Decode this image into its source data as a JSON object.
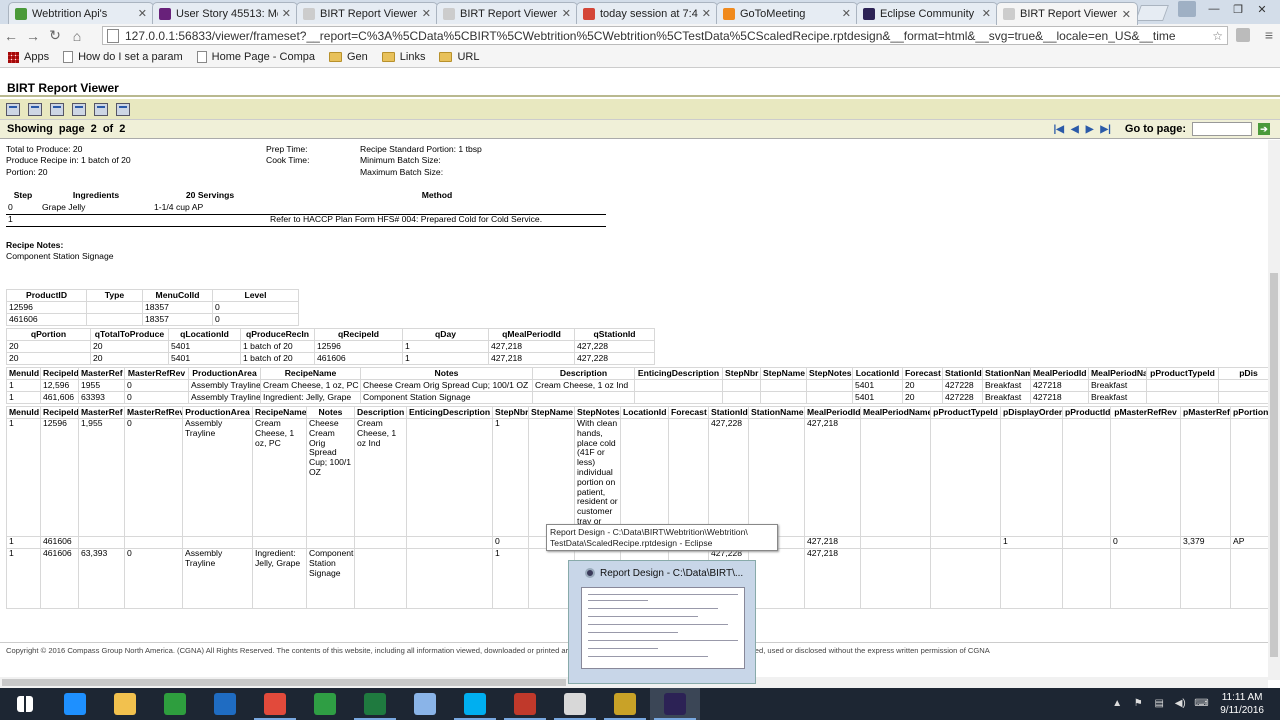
{
  "browser": {
    "tabs": [
      {
        "title": "Webtrition Api's",
        "color": "#4a9a3a",
        "active": false
      },
      {
        "title": "User Story 45513: Men",
        "color": "#68217a",
        "active": false
      },
      {
        "title": "BIRT Report Viewer",
        "color": "#cccccc",
        "active": false
      },
      {
        "title": "BIRT Report Viewer",
        "color": "#cccccc",
        "active": false
      },
      {
        "title": "today session at 7:45p",
        "color": "#d44638",
        "active": false
      },
      {
        "title": "GoToMeeting",
        "color": "#f08a1d",
        "active": false
      },
      {
        "title": "Eclipse Community Fo",
        "color": "#2c2255",
        "active": false
      },
      {
        "title": "BIRT Report Viewer",
        "color": "#cccccc",
        "active": true
      }
    ],
    "url": "127.0.0.1:56833/viewer/frameset?__report=C%3A%5CData%5CBIRT%5CWebtrition%5CWebtrition%5CTestData%5CScaledRecipe.rptdesign&__format=html&__svg=true&__locale=en_US&__time",
    "bookmarks": [
      "Apps",
      "How do I set a param",
      "Home Page - Compa",
      "Gen",
      "Links",
      "URL"
    ]
  },
  "viewer": {
    "title": "BIRT Report Viewer",
    "showing_label": "Showing page",
    "page_current": "2",
    "of_label": "of",
    "page_total": "2",
    "goto_label": "Go to page:"
  },
  "report": {
    "summary": {
      "total_to_produce": "Total to Produce: 20",
      "produce_in": "Produce Recipe in: 1 batch of 20",
      "portion": "Portion: 20",
      "prep_time": "Prep Time:",
      "cook_time": "Cook Time:",
      "std_portion": "Recipe Standard Portion: 1 tbsp",
      "min_batch": "Minimum Batch Size:",
      "max_batch": "Maximum Batch Size:"
    },
    "ingredients": {
      "headers": [
        "Step",
        "Ingredients",
        "20 Servings",
        "Method"
      ],
      "rows": [
        [
          "0",
          "Grape Jelly",
          "1-1/4 cup   AP",
          ""
        ],
        [
          "1",
          "",
          "",
          "Refer to HACCP Plan Form HFS# 004: Prepared Cold for Cold Service."
        ]
      ]
    },
    "notes_label": "Recipe Notes:",
    "notes_text": "Component Station Signage",
    "products": {
      "headers": [
        "ProductID",
        "Type",
        "MenuColId",
        "Level"
      ],
      "rows": [
        [
          "12596",
          "",
          "18357",
          "0"
        ],
        [
          "461606",
          "",
          "18357",
          "0"
        ]
      ]
    },
    "params": {
      "headers": [
        "qPortion",
        "qTotalToProduce",
        "qLocationId",
        "qProduceRecIn",
        "qRecipeId",
        "qDay",
        "qMealPeriodId",
        "qStationId"
      ],
      "rows": [
        [
          "20",
          "20",
          "5401",
          "1 batch of 20",
          "12596",
          "1",
          "427,218",
          "427,228"
        ],
        [
          "20",
          "20",
          "5401",
          "1 batch of 20",
          "461606",
          "1",
          "427,218",
          "427,228"
        ]
      ]
    },
    "recipes": {
      "headers": [
        "MenuId",
        "RecipeId",
        "MasterRef",
        "MasterRefRev",
        "ProductionArea",
        "RecipeName",
        "Notes",
        "Description",
        "EnticingDescription",
        "StepNbr",
        "StepName",
        "StepNotes",
        "LocationId",
        "Forecast",
        "StationId",
        "StationName",
        "MealPeriodId",
        "MealPeriodName",
        "pProductTypeId",
        "pDis"
      ],
      "rows": [
        [
          "1",
          "12,596",
          "1955",
          "0",
          "Assembly Trayline",
          "Cream Cheese, 1 oz, PC",
          "Cheese Cream Orig Spread Cup; 100/1 OZ",
          "Cream Cheese, 1 oz Ind",
          "",
          "",
          "",
          "",
          "5401",
          "20",
          "427228",
          "Breakfast",
          "427218",
          "Breakfast",
          "",
          ""
        ],
        [
          "1",
          "461,606",
          "63393",
          "0",
          "Assembly Trayline",
          "Ingredient: Jelly, Grape",
          "Component Station Signage",
          "",
          "",
          "",
          "",
          "",
          "5401",
          "20",
          "427228",
          "Breakfast",
          "427218",
          "Breakfast",
          "",
          ""
        ]
      ]
    },
    "detail": {
      "headers": [
        "MenuId",
        "RecipeId",
        "MasterRef",
        "MasterRefRev",
        "ProductionArea",
        "RecipeName",
        "Notes",
        "Description",
        "EnticingDescription",
        "StepNbr",
        "StepName",
        "StepNotes",
        "LocationId",
        "Forecast",
        "StationId",
        "StationName",
        "MealPeriodId",
        "MealPeriodName",
        "pProductTypeId",
        "pDisplayOrder",
        "pProductId",
        "pMasterRefRev",
        "pMasterRef",
        "pPortion"
      ],
      "row1": [
        "1",
        "12596",
        "1,955",
        "0",
        "Assembly Trayline",
        "Cream Cheese, 1 oz, PC",
        "Cheese Cream Orig Spread Cup; 100/1 OZ",
        "Cream Cheese, 1 oz Ind",
        "",
        "1",
        "",
        "With clean hands, place cold (41F or less) individual portion on patient, resident or customer tray or",
        "",
        "",
        "427,228",
        "",
        "427,218",
        "",
        "",
        "",
        "",
        "",
        "",
        ""
      ],
      "row2": [
        "1",
        "461606",
        "",
        "",
        "",
        "",
        "",
        "",
        "",
        "0",
        "",
        "",
        "",
        "",
        "427,228",
        "",
        "427,218",
        "",
        "",
        "1",
        "",
        "0",
        "3,379",
        "AP"
      ],
      "row3": [
        "1",
        "461606",
        "63,393",
        "0",
        "Assembly Trayline",
        "Ingredient: Jelly, Grape",
        "Component Station Signage",
        "",
        "",
        "1",
        "",
        "",
        "",
        "",
        "427,228",
        "",
        "427,218",
        "",
        "",
        "",
        "",
        "",
        "",
        ""
      ]
    },
    "footer": "Copyright © 2016 Compass Group North America. (CGNA) All Rights Reserved. The contents of this website, including all information viewed, downloaded or printed are considered confidential to CGNA and may not be copied, used or disclosed without the express written permission of CGNA"
  },
  "tooltip": {
    "line1": "Report Design - C:\\Data\\BIRT\\Webtrition\\Webtrition\\",
    "line2": "TestData\\ScaledRecipe.rptdesign - Eclipse"
  },
  "preview": {
    "title": "Report Design - C:\\Data\\BIRT\\..."
  },
  "taskbar": {
    "apps": [
      {
        "name": "windows-start-icon",
        "color": "#ffffff"
      },
      {
        "name": "internet-explorer-icon",
        "color": "#1e90ff"
      },
      {
        "name": "file-explorer-icon",
        "color": "#f2c14e"
      },
      {
        "name": "store-icon",
        "color": "#2e9e3e"
      },
      {
        "name": "outlook-icon",
        "color": "#1f6cc2"
      },
      {
        "name": "chrome-icon",
        "color": "#e24a3b"
      },
      {
        "name": "calculator-icon",
        "color": "#2f9e44"
      },
      {
        "name": "excel-icon",
        "color": "#1f7a3f"
      },
      {
        "name": "notepad-icon",
        "color": "#8ab4e8"
      },
      {
        "name": "skype-icon",
        "color": "#00aff0"
      },
      {
        "name": "acrobat-icon",
        "color": "#c0392b"
      },
      {
        "name": "window-icon",
        "color": "#d8d8d8"
      },
      {
        "name": "tools-icon",
        "color": "#c9a227"
      },
      {
        "name": "eclipse-icon",
        "color": "#2c2255"
      }
    ],
    "time": "11:11 AM",
    "date": "9/11/2016"
  }
}
